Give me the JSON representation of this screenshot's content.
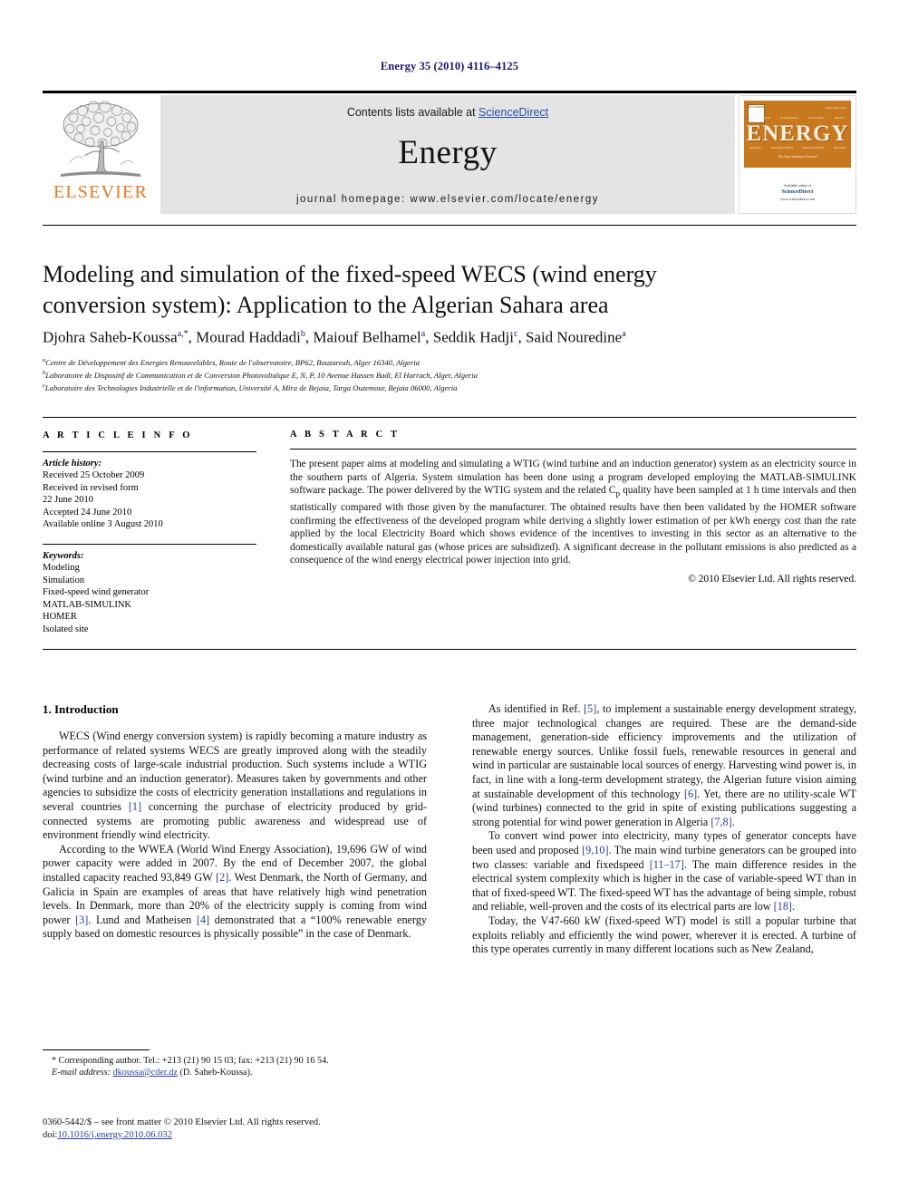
{
  "running_head": "Energy 35 (2010) 4116–4125",
  "masthead": {
    "contents_prefix": "Contents lists available at ",
    "sciencedirect": "ScienceDirect",
    "journal_title": "Energy",
    "homepage": "journal homepage: www.elsevier.com/locate/energy",
    "publisher_logo_text": "ELSEVIER",
    "cover": {
      "title": "ENERGY",
      "subtitle": "The International Journal",
      "issn": "ISSN 0360-5442",
      "badge": "ELSEVIER",
      "topics_top": [
        "TECHNOLOGY",
        "ECONOMICS",
        "PLANNING",
        "POLICY"
      ],
      "topics_bottom": [
        "ENERGY",
        "ENVIRONMENT",
        "MANAGEMENT",
        "HEALTH"
      ],
      "sd_line1": "Available online at",
      "sd_line2": "ScienceDirect",
      "sd_line3": "www.sciencedirect.com"
    }
  },
  "article": {
    "title": "Modeling and simulation of the fixed-speed WECS (wind energy conversion system): Application to the Algerian Sahara area",
    "authors": [
      {
        "name": "Djohra Saheb-Koussa",
        "marks": "a,*"
      },
      {
        "name": "Mourad Haddadi",
        "marks": "b"
      },
      {
        "name": "Maiouf Belhamel",
        "marks": "a"
      },
      {
        "name": "Seddik Hadji",
        "marks": "c"
      },
      {
        "name": "Said Nouredine",
        "marks": "a"
      }
    ],
    "affiliations": [
      {
        "mark": "a",
        "text": "Centre de Développement des Energies Renouvelables, Route de l'observatoire, BP62, Bouzareah, Alger 16340, Algeria"
      },
      {
        "mark": "b",
        "text": "Laboratoire de Dispositif de Communication et de Conversion Photovoltaïque E, N, P, 10 Avenue Hassen Badi, El Harrach, Alger, Algeria"
      },
      {
        "mark": "c",
        "text": "Laboratoire des Technologies Industrielle et de l'information, Université A, Mira de Bejaia, Targa Ouzemour, Bejaia 06000, Algeria"
      }
    ]
  },
  "article_info": {
    "heading": "A R T I C L E   I N F O",
    "history_label": "Article history:",
    "history": [
      "Received 25 October 2009",
      "Received in revised form",
      "22 June 2010",
      "Accepted 24 June 2010",
      "Available online 3 August 2010"
    ],
    "keywords_label": "Keywords:",
    "keywords": [
      "Modeling",
      "Simulation",
      "Fixed-speed wind generator",
      "MATLAB-SIMULINK",
      "HOMER",
      "Isolated site"
    ]
  },
  "abstract": {
    "heading": "A B S T A R C T",
    "body_part1": "The present paper aims at modeling and simulating a WTIG (wind turbine and an induction generator) system as an electricity source in the southern parts of Algeria. System simulation has been done using a program developed employing the MATLAB-SIMULINK software package. The power delivered by the WTIG system and the related C",
    "cp_sub": "p",
    "body_part2": " quality have been sampled at 1 h time intervals and then statistically compared with those given by the manufacturer. The obtained results have then been validated by the HOMER software confirming the effectiveness of the developed program while deriving a slightly lower estimation of per kWh energy cost than the rate applied by the local Electricity Board which shows evidence of the incentives to investing in this sector as an alternative to the domestically available natural gas (whose prices are subsidized). A significant decrease in the pollutant emissions is also predicted as a consequence of the wind energy electrical power injection into grid.",
    "copyright": "© 2010 Elsevier Ltd. All rights reserved."
  },
  "body": {
    "section_heading": "1. Introduction",
    "left_p1_a": "WECS (Wind energy conversion system) is rapidly becoming a mature industry as performance of related systems WECS are greatly improved along with the steadily decreasing costs of large-scale industrial production. Such systems include a WTIG (wind turbine and an induction generator). Measures taken by governments and other agencies to subsidize the costs of electricity generation installations and regulations in several countries ",
    "left_p1_ref1": "[1]",
    "left_p1_b": " concerning the purchase of electricity produced by grid-connected systems are promoting public awareness and widespread use of environment friendly wind electricity.",
    "left_p2_a": "According to the WWEA (World Wind Energy Association), 19,696 GW of wind power capacity were added in 2007. By the end of December 2007, the global installed capacity reached 93,849 GW ",
    "left_p2_ref2": "[2]",
    "left_p2_b": ". West Denmark, the North of Germany, and Galicia in Spain are examples of areas that have relatively high wind penetration levels. In Denmark, more than 20% of the electricity supply is coming from wind power ",
    "left_p2_ref3": "[3]",
    "left_p2_c": ". Lund and Matheisen ",
    "left_p2_ref4": "[4]",
    "left_p2_d": " demonstrated that a “100% renewable energy supply based on domestic resources is physically possible” in the case of Denmark.",
    "right_p1_a": "As identified in Ref. ",
    "right_p1_ref5": "[5]",
    "right_p1_b": ", to implement a sustainable energy development strategy, three major technological changes are required. These are the demand-side management, generation-side efficiency improvements and the utilization of renewable energy sources. Unlike fossil fuels, renewable resources in general and wind in particular are sustainable local sources of energy. Harvesting wind power is, in fact, in line with a long-term development strategy, the Algerian future vision aiming at sustainable development of this technology ",
    "right_p1_ref6": "[6]",
    "right_p1_c": ". Yet, there are no utility-scale WT (wind turbines) connected to the grid in spite of existing publications suggesting a strong potential for wind power generation in Algeria ",
    "right_p1_ref78": "[7,8]",
    "right_p1_d": ".",
    "right_p2_a": "To convert wind power into electricity, many types of generator concepts have been used and proposed ",
    "right_p2_ref910": "[9,10]",
    "right_p2_b": ". The main wind turbine generators can be grouped into two classes: variable and fixedspeed ",
    "right_p2_ref1117": "[11–17]",
    "right_p2_c": ". The main difference resides in the electrical system complexity which is higher in the case of variable-speed WT than in that of fixed-speed WT. The fixed-speed WT has the advantage of being simple, robust and reliable, well-proven and the costs of its electrical parts are low ",
    "right_p2_ref18": "[18]",
    "right_p2_d": ".",
    "right_p3": "Today, the V47-660 kW (fixed-speed WT) model is still a popular turbine that exploits reliably and efficiently the wind power, wherever it is erected. A turbine of this type operates currently in many different locations such as New Zealand,"
  },
  "footnotes": {
    "corresponding": "* Corresponding author. Tel.: +213 (21) 90 15 03; fax: +213 (21) 90 16 54.",
    "email_label": "E-mail address:",
    "email": "dkoussa@cder.dz",
    "email_suffix": "(D. Saheb-Koussa).",
    "imprint": "0360-5442/$ – see front matter © 2010 Elsevier Ltd. All rights reserved.",
    "doi_label": "doi:",
    "doi": "10.1016/j.energy.2010.06.032"
  },
  "colors": {
    "link": "#2b3f9e",
    "elsevier_orange": "#E87722",
    "cover_orange": "#C8781F",
    "band_gray": "#e4e4e4",
    "running_head": "#1a1a6e"
  }
}
